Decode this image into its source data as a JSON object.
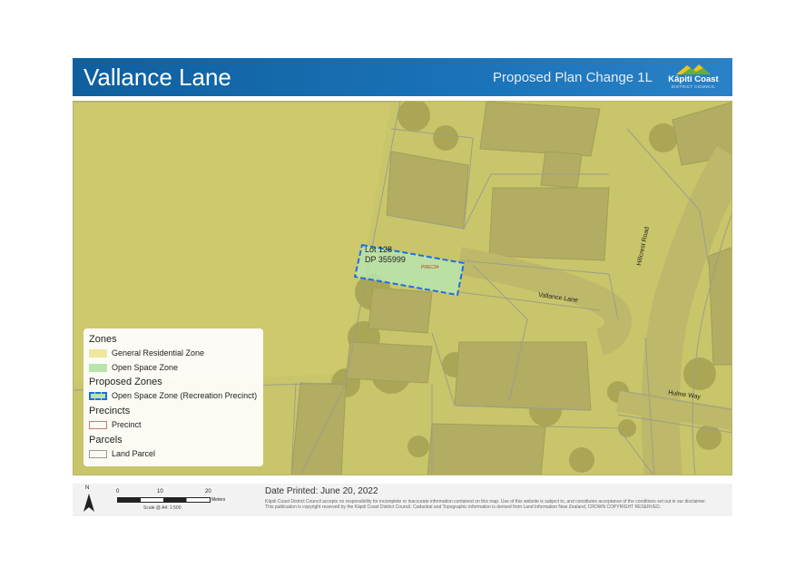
{
  "header": {
    "title": "Vallance Lane",
    "subtitle": "Proposed Plan Change 1L",
    "logo_name": "Kāpiti Coast",
    "logo_sub": "DISTRICT COUNCIL"
  },
  "map": {
    "lot_label_1": "Lot 128",
    "lot_label_2": "DP 355999",
    "precinct_code": "PREC34",
    "street_vallance": "Vallance Lane",
    "street_hillcrest": "Hillcrest Road",
    "street_hulme": "Hulme Way"
  },
  "legend": {
    "zones_heading": "Zones",
    "general_residential": "General Residential Zone",
    "open_space": "Open Space Zone",
    "proposed_heading": "Proposed Zones",
    "proposed_open_space": "Open Space Zone (Recreation Precinct)",
    "precincts_heading": "Precincts",
    "precinct": "Precinct",
    "parcels_heading": "Parcels",
    "land_parcel": "Land Parcel",
    "colors": {
      "general_residential": "#efe89a",
      "open_space": "#b9e4ad",
      "proposed_border": "#1e6fe0",
      "precinct_border": "#c77a6a",
      "parcel_border": "#9a9a9a"
    }
  },
  "footer": {
    "north_label": "N",
    "scale_0": "0",
    "scale_10": "10",
    "scale_20": "20",
    "scale_unit": "Meters",
    "scale_note": "Scale @ A4: 1:500",
    "date_printed": "Date Printed: June 20, 2022",
    "disclaimer_1": "Kāpiti Coast District Council accepts no responsibility for incomplete or inaccurate information contained on this map. Use of this website is subject to, and constitutes acceptance of the conditions set out in our disclaimer.",
    "disclaimer_2": "This publication is copyright reserved by the Kāpiti Coast District Council. Cadastral and Topographic information is derived from Land Information New Zealand, CROWN COPYRIGHT RESERVED."
  }
}
